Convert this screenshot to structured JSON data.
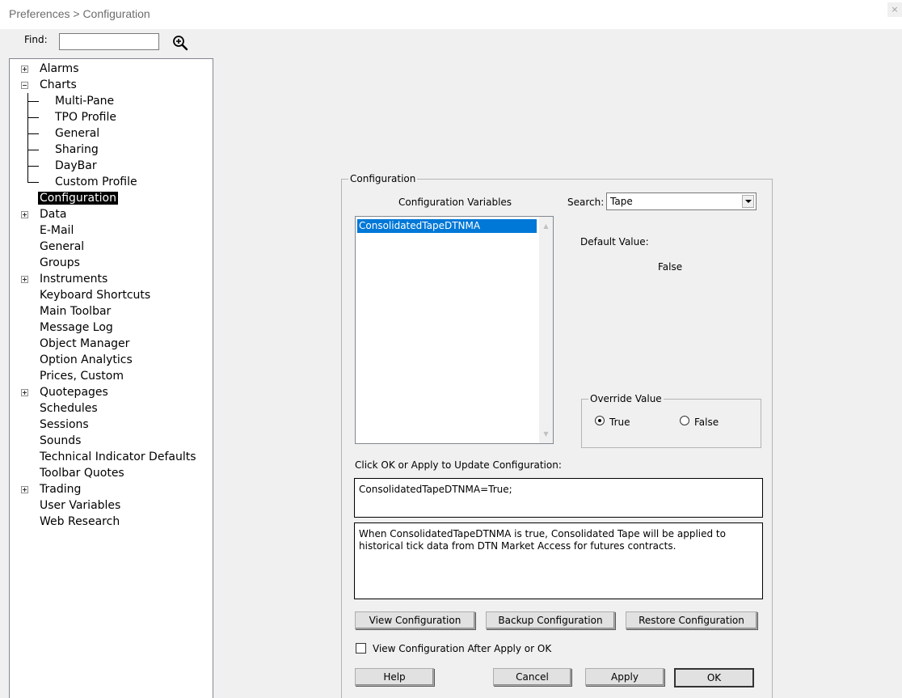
{
  "window": {
    "title": "Preferences > Configuration",
    "close_glyph": "×"
  },
  "find": {
    "label": "Find:",
    "value": "",
    "icon": "zoom-in-icon"
  },
  "tree": {
    "items": [
      {
        "label": "Alarms"
      },
      {
        "label": "Charts"
      },
      {
        "label": "Multi-Pane"
      },
      {
        "label": "TPO Profile"
      },
      {
        "label": "General"
      },
      {
        "label": "Sharing"
      },
      {
        "label": "DayBar"
      },
      {
        "label": "Custom Profile"
      },
      {
        "label": "Configuration",
        "selected": true
      },
      {
        "label": "Data"
      },
      {
        "label": "E-Mail"
      },
      {
        "label": "General"
      },
      {
        "label": "Groups"
      },
      {
        "label": "Instruments"
      },
      {
        "label": "Keyboard Shortcuts"
      },
      {
        "label": "Main Toolbar"
      },
      {
        "label": "Message Log"
      },
      {
        "label": "Object Manager"
      },
      {
        "label": "Option Analytics"
      },
      {
        "label": "Prices, Custom"
      },
      {
        "label": "Quotepages"
      },
      {
        "label": "Schedules"
      },
      {
        "label": "Sessions"
      },
      {
        "label": "Sounds"
      },
      {
        "label": "Technical Indicator Defaults"
      },
      {
        "label": "Toolbar Quotes"
      },
      {
        "label": "Trading"
      },
      {
        "label": "User Variables"
      },
      {
        "label": "Web Research"
      }
    ]
  },
  "config": {
    "group_title": "Configuration",
    "variables_label": "Configuration Variables",
    "variables": [
      "ConsolidatedTapeDTNMA"
    ],
    "search_label": "Search:",
    "search_value": "Tape",
    "default_value_label": "Default Value:",
    "default_value": "False",
    "override": {
      "title": "Override Value",
      "true_label": "True",
      "false_label": "False",
      "selected": "True"
    },
    "update_label": "Click OK or Apply to Update Configuration:",
    "update_text": "ConsolidatedTapeDTNMA=True;",
    "description": "When ConsolidatedTapeDTNMA is true, Consolidated Tape will be applied to historical tick data from DTN Market Access for futures contracts.",
    "buttons": {
      "view": "View Configuration",
      "backup": "Backup Configuration",
      "restore": "Restore Configuration"
    },
    "view_after_label": "View Configuration After Apply or OK",
    "view_after_checked": false
  },
  "dialog_buttons": {
    "help": "Help",
    "cancel": "Cancel",
    "apply": "Apply",
    "ok": "OK"
  }
}
